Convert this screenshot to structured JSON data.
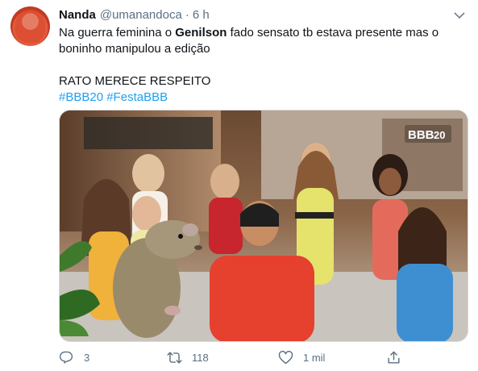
{
  "tweet": {
    "display_name": "Nanda",
    "handle": "@umanandoca",
    "separator": "·",
    "time": "6 h",
    "text": {
      "line1_before": "Na guerra feminina o ",
      "line1_bold": "Genilson",
      "line1_after": " fado sensato tb estava presente mas o",
      "line2": "boninho manipulou a edição",
      "line3": "RATO MERECE RESPEITO",
      "hashtag1": "#BBB20",
      "hashtag2": "#FestaBBB"
    },
    "media": {
      "watermark": "BBB",
      "watermark_num": "20"
    },
    "actions": {
      "reply_count": "3",
      "retweet_count": "118",
      "like_count": "1 mil"
    }
  },
  "colors": {
    "text": "#0f1419",
    "secondary": "#5b7083",
    "link": "#1da1f2"
  },
  "icons": [
    "chevron-down-icon",
    "reply-icon",
    "retweet-icon",
    "like-icon",
    "share-icon"
  ]
}
